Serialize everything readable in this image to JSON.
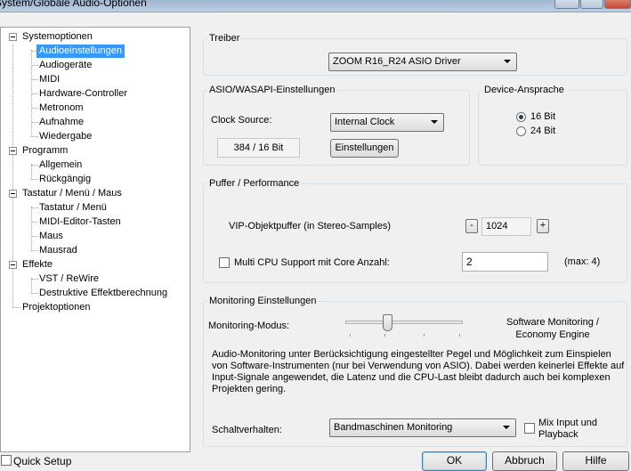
{
  "window": {
    "title": "System/Globale Audio-Optionen"
  },
  "tree": {
    "systemoptionen": "Systemoptionen",
    "audioeinstellungen": "Audioeinstellungen",
    "audiogeraete": "Audiogeräte",
    "midi": "MIDI",
    "hardware_controller": "Hardware-Controller",
    "metronom": "Metronom",
    "aufnahme": "Aufnahme",
    "wiedergabe": "Wiedergabe",
    "programm": "Programm",
    "allgemein": "Allgemein",
    "rueckgaengig": "Rückgängig",
    "tastatur_menue_maus": "Tastatur / Menü / Maus",
    "tastatur_menue": "Tastatur / Menü",
    "midi_editor_tasten": "MIDI-Editor-Tasten",
    "maus": "Maus",
    "mausrad": "Mausrad",
    "effekte": "Effekte",
    "vst_rewire": "VST / ReWire",
    "destruktive": "Destruktive Effektberechnung",
    "projektoptionen": "Projektoptionen"
  },
  "treiber": {
    "label": "Treiber",
    "driver": "ZOOM R16_R24 ASIO Driver"
  },
  "asio": {
    "label": "ASIO/WASAPI-Einstellungen",
    "clock_label": "Clock Source:",
    "clock_value": "Internal Clock",
    "bitrate": "384 / 16 Bit",
    "einstellungen": "Einstellungen"
  },
  "device": {
    "label": "Device-Ansprache",
    "opt16": "16 Bit",
    "opt24": "24 Bit"
  },
  "puffer": {
    "label": "Puffer / Performance",
    "vip_label": "VIP-Objektpuffer (in Stereo-Samples)",
    "minus": "-",
    "vip_value": "1024",
    "plus": "+",
    "multi_cpu_label": "Multi CPU Support mit Core Anzahl:",
    "multi_cpu_value": "2",
    "max": "(max: 4)"
  },
  "monitoring": {
    "label": "Monitoring Einstellungen",
    "modus_label": "Monitoring-Modus:",
    "mode_line1": "Software Monitoring /",
    "mode_line2": "Economy Engine",
    "slider_level": 0.35,
    "desc1": "Audio-Monitoring unter Berücksichtigung eingestellter Pegel und Möglichkeit zum Einspielen",
    "desc2": "von Software-Instrumenten (nur bei Verwendung von ASIO). Dabei werden keinerlei Effekte auf",
    "desc3": "Input-Signale angewendet, die Latenz und die CPU-Last bleibt dadurch auch bei komplexen",
    "desc4": "Projekten gering.",
    "schalt_label": "Schaltverhalten:",
    "schalt_value": "Bandmaschinen Monitoring",
    "mix_line1": "Mix Input und",
    "mix_line2": "Playback"
  },
  "footer": {
    "quick_setup": "Quick Setup",
    "ok": "OK",
    "abbruch": "Abbruch",
    "hilfe": "Hilfe"
  },
  "colors": {
    "selection": "#3399ff",
    "background": "#f0f0f0"
  }
}
